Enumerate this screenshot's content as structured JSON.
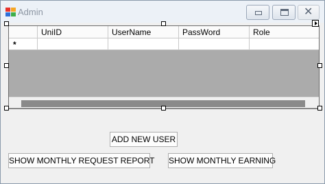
{
  "window": {
    "title": "Admin",
    "controls": {
      "minimize": "minimize",
      "maximize": "maximize",
      "close": "✕"
    }
  },
  "grid": {
    "columns": [
      "UniID",
      "UserName",
      "PassWord",
      "Role"
    ],
    "new_row_marker": "*"
  },
  "buttons": {
    "add_new_user": "ADD NEW USER",
    "monthly_request_report": "SHOW MONTHLY REQUEST REPORT",
    "monthly_earning": "SHOW MONTHLY EARNING"
  },
  "colors": {
    "grid_background": "#ababab",
    "form_background": "#f0f0f0",
    "app_icon": [
      "#e8322a",
      "#f5a623",
      "#2e6fd8",
      "#3fae49"
    ]
  }
}
